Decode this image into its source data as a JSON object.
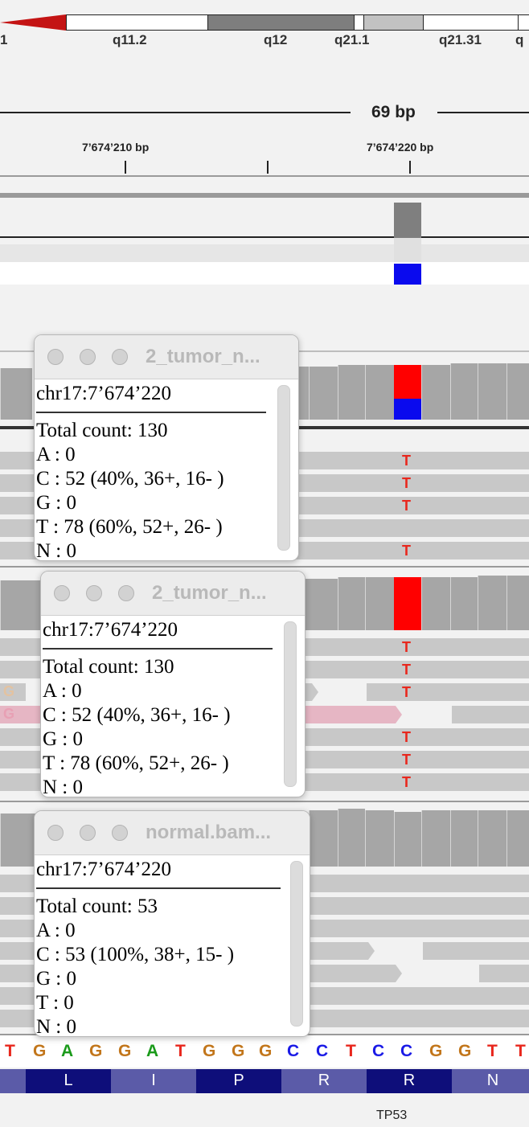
{
  "ideogram": {
    "left_label": "1",
    "bands": [
      "q11.2",
      "q12",
      "q21.1",
      "q21.31",
      "q"
    ]
  },
  "ruler": {
    "span": "69 bp",
    "ticks": [
      "7’674’210 bp",
      "7’674’220 bp"
    ]
  },
  "popups": [
    {
      "title": "2_tumor_n...",
      "position": "chr17:7’674’220",
      "total": "Total count: 130",
      "a": "A : 0",
      "c": "C : 52 (40%, 36+, 16- )",
      "g": "G : 0",
      "t": "T : 78 (60%, 52+, 26- )",
      "n": "N : 0"
    },
    {
      "title": "2_tumor_n...",
      "position": "chr17:7’674’220",
      "total": "Total count: 130",
      "a": "A : 0",
      "c": "C : 52 (40%, 36+, 16- )",
      "g": "G : 0",
      "t": "T : 78 (60%, 52+, 26- )",
      "n": "N : 0"
    },
    {
      "title": "normal.bam...",
      "position": "chr17:7’674’220",
      "total": "Total count: 53",
      "a": "A : 0",
      "c": "C : 53 (100%, 38+, 15- )",
      "g": "G : 0",
      "t": "T : 0",
      "n": "N : 0"
    }
  ],
  "mismatch_base": "T",
  "read_base_g": "G",
  "sequence": [
    "T",
    "G",
    "A",
    "G",
    "G",
    "A",
    "T",
    "G",
    "G",
    "G",
    "C",
    "C",
    "T",
    "C",
    "C",
    "G",
    "G",
    "T",
    "T"
  ],
  "amino_acids": [
    "L",
    "I",
    "P",
    "R",
    "R",
    "N"
  ],
  "gene": "TP53",
  "colors": {
    "A": "#1a9a1a",
    "C": "#1a1ae6",
    "G": "#c2761b",
    "T": "#e8271d",
    "aa_dark": "#0e0e7a",
    "aa_light": "#5b5ba8"
  }
}
